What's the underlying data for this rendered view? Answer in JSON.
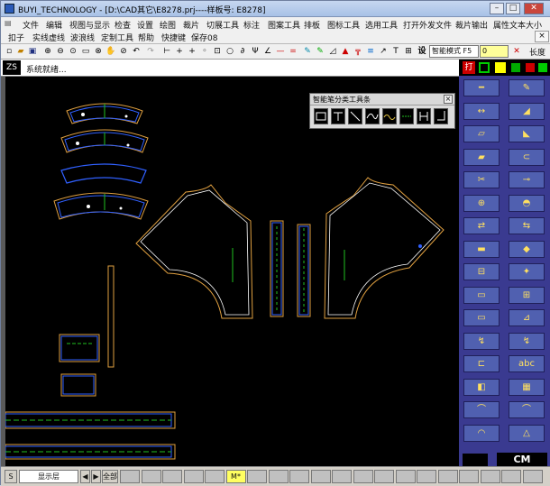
{
  "titlebar": {
    "title": "BUYI_TECHNOLOGY - [D:\\CAD其它\\E8278.prj----样板号: E8278]",
    "minimize": "–",
    "maximize": "□",
    "close": "✕"
  },
  "menu": {
    "row1": [
      "文件",
      "编辑",
      "视图与显示",
      "检查",
      "设置",
      "绘图",
      "裁片",
      "切展工具",
      "标注",
      "图案工具",
      "排板",
      "图标工具",
      "选用工具",
      "打开外发文件",
      "裁片输出",
      "属性文本大小"
    ],
    "row2": [
      "扣子",
      "实线虚线",
      "波浪线",
      "定制工具",
      "帮助",
      "快捷键",
      "保存08"
    ],
    "close_doc": "×"
  },
  "toolbar": {
    "text_button": "设",
    "mode_select": "智能模式 F5",
    "number_box": "0",
    "width_label": "长度"
  },
  "status": {
    "logo": "ZS",
    "message": "系统就绪..."
  },
  "float_toolbar": {
    "title": "智能笔分类工具条",
    "close": "×"
  },
  "palette": {
    "top_label": "打",
    "bottom_badge": "CM"
  },
  "bottombar": {
    "s_label": "S",
    "layer_label": "显示层",
    "prev": "◀",
    "next": "▶",
    "all_label": "全部",
    "marker": "M*"
  },
  "colors": {
    "canvas_bg": "#000000",
    "pattern_orange": "#e0a040",
    "pattern_blue": "#3060ff",
    "pattern_white": "#ffffff",
    "pattern_green": "#20c020",
    "palette_bg": "#3a3a90"
  }
}
